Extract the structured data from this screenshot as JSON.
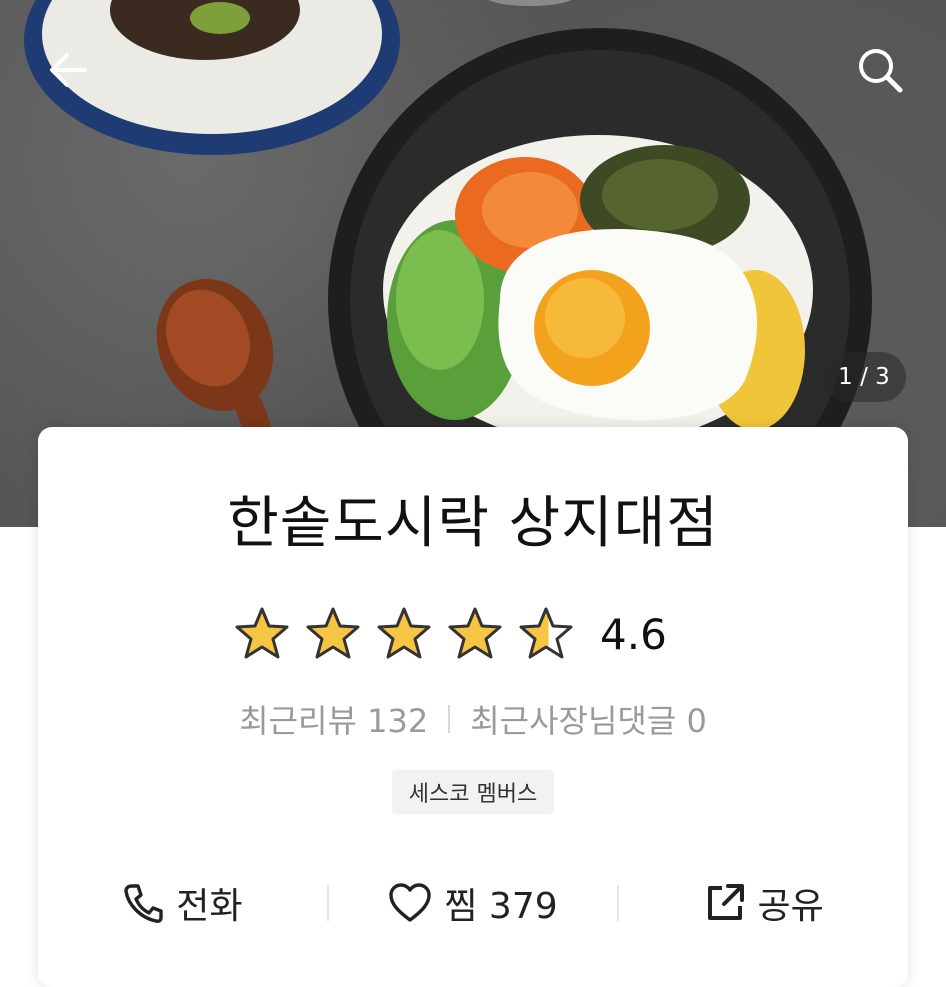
{
  "hero": {
    "image_description_icon": "bibimbap-photo",
    "page_current": "1",
    "page_total": "3",
    "page_indicator": "1 / 3"
  },
  "topbar": {
    "back_icon": "arrow-left-icon",
    "search_icon": "search-icon"
  },
  "store": {
    "name": "한솥도시락 상지대점",
    "rating": "4.6",
    "rating_value": 4.6,
    "stars_max": 5,
    "recent_reviews_label": "최근리뷰 132",
    "recent_owner_replies_label": "최근사장님댓글 0",
    "badge": "세스코 멤버스"
  },
  "actions": {
    "call_label": "전화",
    "like_label": "찜 379",
    "share_label": "공유"
  },
  "colors": {
    "star_fill": "#f6c544",
    "star_stroke": "#333333",
    "text_primary": "#111111",
    "text_secondary": "#9a9a9a"
  }
}
